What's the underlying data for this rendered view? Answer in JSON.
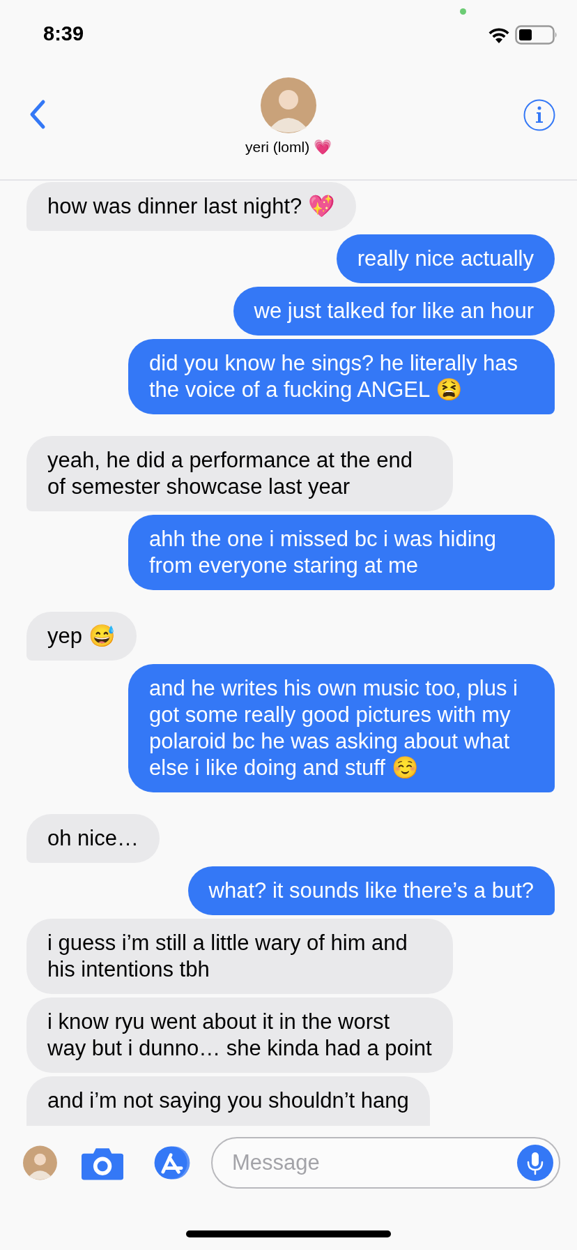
{
  "status_bar": {
    "time": "8:39"
  },
  "header": {
    "contact_name": "yeri (loml) 💗"
  },
  "messages": [
    {
      "kind": "received",
      "text": "how was dinner last night? 💖"
    },
    {
      "kind": "sent",
      "text": "really nice actually"
    },
    {
      "kind": "sent",
      "text": "we just talked for like an hour"
    },
    {
      "kind": "sent",
      "text": "did you know he sings? he literally has the voice of a fucking ANGEL 😫"
    },
    {
      "kind": "received",
      "text": "yeah, he did a performance at the end of semester showcase last year"
    },
    {
      "kind": "sent",
      "text": "ahh the one i missed bc i was hiding from everyone staring at me"
    },
    {
      "kind": "received",
      "text": "yep 😅"
    },
    {
      "kind": "sent",
      "text": "and he writes his own music too, plus i got some really good pictures with my polaroid bc he was asking about what else i like doing and stuff ☺️"
    },
    {
      "kind": "received",
      "text": "oh nice…"
    },
    {
      "kind": "sent",
      "text": "what? it sounds like there’s a but?"
    },
    {
      "kind": "received",
      "text": "i guess i’m still a little wary of him and his intentions tbh"
    },
    {
      "kind": "received",
      "text": "i know ryu went about it in the worst way but i dunno… she kinda had a point"
    },
    {
      "kind": "received",
      "text": "and i’m not saying you shouldn’t hang"
    }
  ],
  "composer": {
    "placeholder": "Message"
  }
}
